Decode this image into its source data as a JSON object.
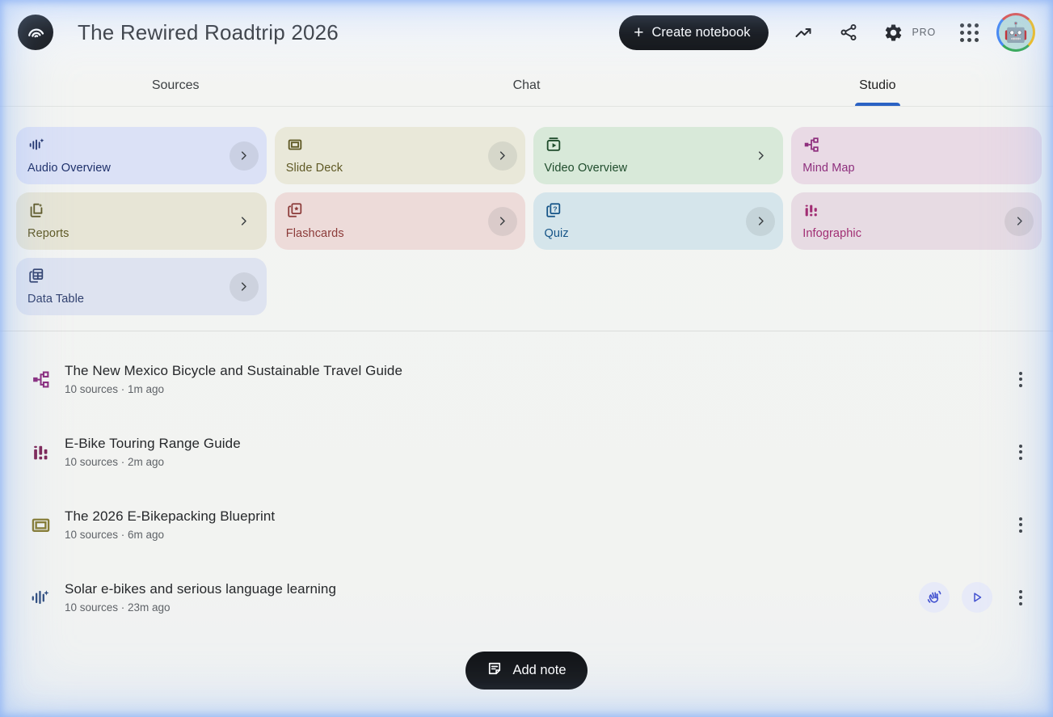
{
  "header": {
    "title": "The Rewired Roadtrip 2026",
    "create_button_label": "Create notebook",
    "pro_badge": "PRO"
  },
  "tabs": [
    {
      "label": "Sources",
      "active": false
    },
    {
      "label": "Chat",
      "active": false
    },
    {
      "label": "Studio",
      "active": true
    }
  ],
  "colors": {
    "accent_blue": "#2a62c4",
    "button_black": "#131518",
    "edge_glow_blue": "#9cbff0"
  },
  "studio_cards": [
    {
      "label": "Audio Overview",
      "icon": "audio-waveform-sparkle-icon",
      "bg": "#dbe1f6",
      "fg": "#1d2f69",
      "chevron": "circled"
    },
    {
      "label": "Slide Deck",
      "icon": "slide-frame-icon",
      "bg": "#e9e8d9",
      "fg": "#5e5824",
      "chevron": "circled"
    },
    {
      "label": "Video Overview",
      "icon": "video-player-icon",
      "bg": "#d8e9d9",
      "fg": "#1f4c2c",
      "chevron": "plain"
    },
    {
      "label": "Mind Map",
      "icon": "mind-map-nodes-icon",
      "bg": "#e9dae5",
      "fg": "#8e2f7d",
      "chevron": "none"
    },
    {
      "label": "Reports",
      "icon": "report-doc-sparkle-icon",
      "bg": "#e7e5d6",
      "fg": "#5e5824",
      "chevron": "plain"
    },
    {
      "label": "Flashcards",
      "icon": "flashcards-star-icon",
      "bg": "#eddbd9",
      "fg": "#8c3b39",
      "chevron": "circled"
    },
    {
      "label": "Quiz",
      "icon": "quiz-cards-question-icon",
      "bg": "#d5e5eb",
      "fg": "#155487",
      "chevron": "circled"
    },
    {
      "label": "Infographic",
      "icon": "bar-chart-icon",
      "bg": "#e7dbe3",
      "fg": "#a12e73",
      "chevron": "circled"
    },
    {
      "label": "Data Table",
      "icon": "data-table-grid-icon",
      "bg": "#dee3f0",
      "fg": "#30406e",
      "chevron": "circled"
    }
  ],
  "artifacts": [
    {
      "title": "The New Mexico Bicycle and Sustainable Travel Guide",
      "meta": "10 sources · 1m ago",
      "icon": "mind-map-nodes-icon",
      "icon_color": "#8a2b7d"
    },
    {
      "title": "E-Bike Touring Range Guide",
      "meta": "10 sources · 2m ago",
      "icon": "bar-chart-icon",
      "icon_color": "#7c2455"
    },
    {
      "title": "The 2026 E-Bikepacking Blueprint",
      "meta": "10 sources · 6m ago",
      "icon": "slide-frame-icon",
      "icon_color": "#857a30"
    },
    {
      "title": "Solar e-bikes and serious language learning",
      "meta": "10 sources · 23m ago",
      "icon": "audio-waveform-sparkle-icon",
      "icon_color": "#2c4a7c"
    }
  ],
  "playback": {
    "interactive_button": "interactive-mode",
    "play_button": "play-audio",
    "icon_color": "#4353d0"
  },
  "add_note": {
    "label": "Add note"
  }
}
